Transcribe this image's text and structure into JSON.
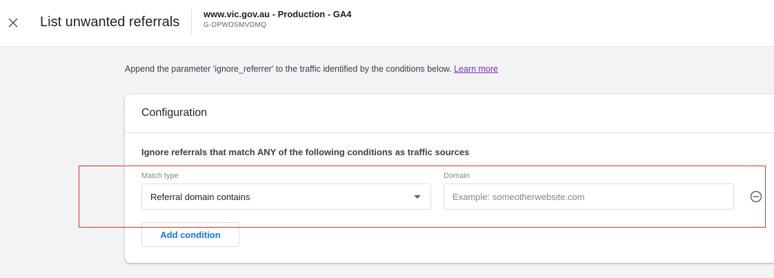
{
  "header": {
    "close_icon": "close-icon",
    "title": "List unwanted referrals",
    "property_name": "www.vic.gov.au - Production - GA4",
    "property_id": "G-DPWDSMVDMQ"
  },
  "description": {
    "text": "Append the parameter 'ignore_referrer' to the traffic identified by the conditions below.",
    "link_label": "Learn more"
  },
  "card": {
    "title": "Configuration",
    "section_heading": "Ignore referrals that match ANY of the following conditions as traffic sources",
    "condition": {
      "match_type_label": "Match type",
      "match_type_value": "Referral domain contains",
      "domain_label": "Domain",
      "domain_placeholder": "Example: someotherwebsite.com",
      "domain_value": "",
      "remove_icon": "remove-circle-icon"
    },
    "add_button_label": "Add condition"
  },
  "colors": {
    "accent": "#1a73e8",
    "link": "#7b2cbf",
    "highlight": "#e8261c",
    "background": "#f1f3f4"
  }
}
